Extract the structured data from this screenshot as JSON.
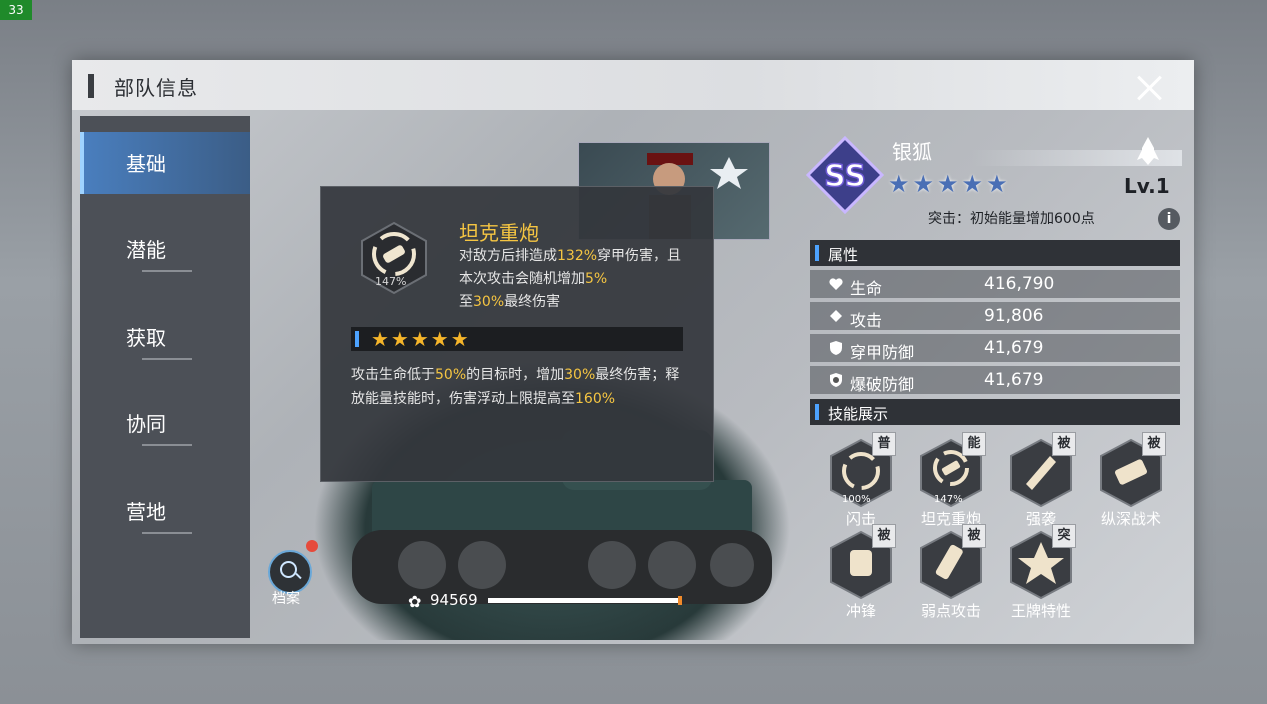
{
  "fps": "33",
  "window": {
    "title": "部队信息"
  },
  "sidebar": {
    "items": [
      {
        "label": "基础",
        "active": true
      },
      {
        "label": "潜能"
      },
      {
        "label": "获取"
      },
      {
        "label": "协同"
      },
      {
        "label": "营地"
      }
    ]
  },
  "tooltip": {
    "skill_name": "坦克重炮",
    "icon_pct": "147%",
    "desc": {
      "p1": "对敌方后排造成",
      "h1": "132%",
      "p2": "穿甲伤害，且本次攻击会随机增加",
      "h2": "5%",
      "p3": "至",
      "h3": "30%",
      "p4": "最终伤害"
    },
    "stars": "★★★★★",
    "star_count": 5,
    "desc2": {
      "p1": "攻击生命低于",
      "h1": "50%",
      "p2": "的目标时，增加",
      "h2": "30%",
      "p3": "最终伤害；释放能量技能时，伤害浮动上限提高至",
      "h3": "160%"
    }
  },
  "dossier": {
    "label": "档案"
  },
  "power": {
    "value": "94569"
  },
  "unit": {
    "grade": "SS",
    "name": "银狐",
    "stars": "★★★★★",
    "star_count": 5,
    "level": "Lv.1",
    "breakthrough": "突击：初始能量增加600点",
    "info_icon": "i"
  },
  "attributes": {
    "header": "属性",
    "rows": [
      {
        "icon": "heart-icon",
        "label": "生命",
        "value": "416,790"
      },
      {
        "icon": "attack-icon",
        "label": "攻击",
        "value": "91,806"
      },
      {
        "icon": "armor-shield-icon",
        "label": "穿甲防御",
        "value": "41,679"
      },
      {
        "icon": "blast-shield-icon",
        "label": "爆破防御",
        "value": "41,679"
      }
    ]
  },
  "skills": {
    "header": "技能展示",
    "items": [
      {
        "tag": "普",
        "name": "闪击",
        "pct": "100%"
      },
      {
        "tag": "能",
        "name": "坦克重炮",
        "pct": "147%"
      },
      {
        "tag": "被",
        "name": "强袭"
      },
      {
        "tag": "被",
        "name": "纵深战术"
      },
      {
        "tag": "被",
        "name": "冲锋"
      },
      {
        "tag": "被",
        "name": "弱点攻击"
      },
      {
        "tag": "突",
        "name": "王牌特性"
      }
    ]
  },
  "colors": {
    "highlight": "#f5c542",
    "accent": "#4da3ff",
    "panel": "#2f3237"
  }
}
